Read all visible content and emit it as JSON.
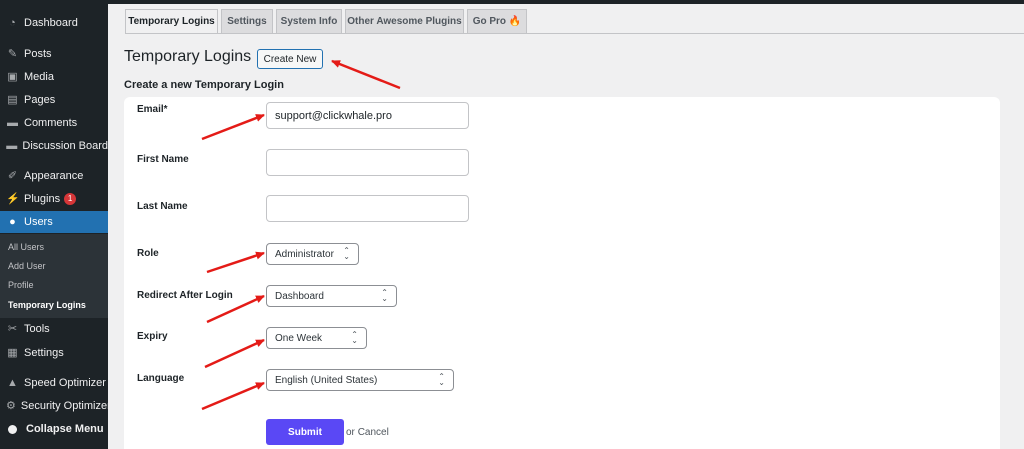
{
  "sidebar": {
    "items": [
      {
        "label": "Dashboard",
        "icon": "dashboard-icon"
      },
      {
        "label": "Posts",
        "icon": "pin-icon"
      },
      {
        "label": "Media",
        "icon": "media-icon"
      },
      {
        "label": "Pages",
        "icon": "pages-icon"
      },
      {
        "label": "Comments",
        "icon": "comment-icon"
      },
      {
        "label": "Discussion Board",
        "icon": "comment-icon"
      },
      {
        "label": "Appearance",
        "icon": "brush-icon"
      },
      {
        "label": "Plugins",
        "icon": "plugin-icon",
        "badge": "1"
      },
      {
        "label": "Users",
        "icon": "user-icon"
      },
      {
        "label": "Tools",
        "icon": "wrench-icon"
      },
      {
        "label": "Settings",
        "icon": "settings-icon"
      },
      {
        "label": "Speed Optimizer",
        "icon": "speed-icon"
      },
      {
        "label": "Security Optimizer",
        "icon": "gear-icon"
      },
      {
        "label": "Collapse Menu",
        "icon": "collapse-icon"
      }
    ],
    "submenu": [
      "All Users",
      "Add User",
      "Profile",
      "Temporary Logins"
    ]
  },
  "tabs": [
    "Temporary Logins",
    "Settings",
    "System Info",
    "Other Awesome Plugins",
    "Go Pro 🔥"
  ],
  "page": {
    "title": "Temporary Logins",
    "create_button": "Create New",
    "subheading": "Create a new Temporary Login"
  },
  "form": {
    "email_label": "Email*",
    "email_value": "support@clickwhale.pro",
    "first_name_label": "First Name",
    "first_name_value": "",
    "last_name_label": "Last Name",
    "last_name_value": "",
    "role_label": "Role",
    "role_value": "Administrator",
    "redirect_label": "Redirect After Login",
    "redirect_value": "Dashboard",
    "expiry_label": "Expiry",
    "expiry_value": "One Week",
    "language_label": "Language",
    "language_value": "English (United States)",
    "submit_label": "Submit",
    "or_text": "or",
    "cancel_label": "Cancel"
  },
  "colors": {
    "sidebar_bg": "#1d2327",
    "active_menu": "#2271b1",
    "submit_bg": "#5a48f5",
    "arrow": "#e41b17"
  }
}
